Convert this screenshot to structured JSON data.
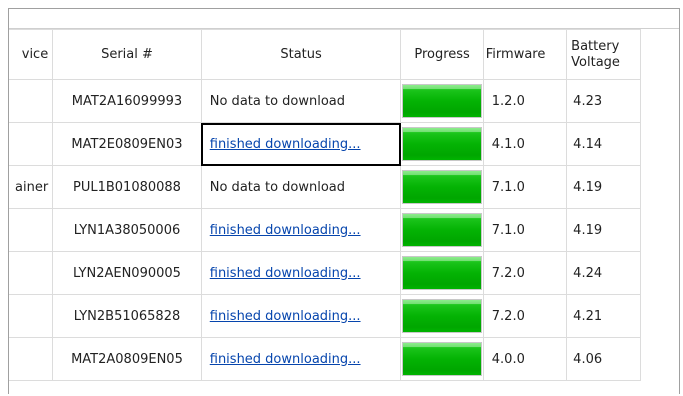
{
  "table": {
    "columns": {
      "device": "vice",
      "serial": "Serial #",
      "status": "Status",
      "progress": "Progress",
      "firmware": "Firmware",
      "battery_line1": "Battery",
      "battery_line2": "Voltage"
    },
    "rows": [
      {
        "device": "",
        "serial": "MAT2A16099993",
        "status": "No data to download",
        "status_link": false,
        "progress": 1.0,
        "firmware": "1.2.0",
        "battery": "4.23"
      },
      {
        "device": "",
        "serial": "MAT2E0809EN03",
        "status": "finished downloading...",
        "status_link": true,
        "progress": 1.0,
        "firmware": "4.1.0",
        "battery": "4.14"
      },
      {
        "device": "ainer",
        "serial": "PUL1B01080088",
        "status": "No data to download",
        "status_link": false,
        "progress": 1.0,
        "firmware": "7.1.0",
        "battery": "4.19"
      },
      {
        "device": "",
        "serial": "LYN1A38050006",
        "status": "finished downloading...",
        "status_link": true,
        "progress": 1.0,
        "firmware": "7.1.0",
        "battery": "4.19"
      },
      {
        "device": "",
        "serial": "LYN2AEN090005",
        "status": "finished downloading...",
        "status_link": true,
        "progress": 1.0,
        "firmware": "7.2.0",
        "battery": "4.24"
      },
      {
        "device": "",
        "serial": "LYN2B51065828",
        "status": "finished downloading...",
        "status_link": true,
        "progress": 1.0,
        "firmware": "7.2.0",
        "battery": "4.21"
      },
      {
        "device": "",
        "serial": "MAT2A0809EN05",
        "status": "finished downloading...",
        "status_link": true,
        "progress": 1.0,
        "firmware": "4.0.0",
        "battery": "4.06"
      }
    ],
    "focused_row": 1
  },
  "colors": {
    "progress_fill": "#00b000",
    "link": "#0645ad",
    "grid_line": "#dcdcdc"
  }
}
